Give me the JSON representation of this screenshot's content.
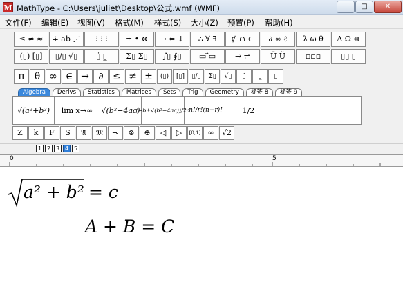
{
  "window": {
    "title": "MathType - C:\\Users\\juliet\\Desktop\\公式.wmf (WMF)",
    "app_icon_glyph": "M",
    "minimize": "─",
    "maximize": "□",
    "close": "✕"
  },
  "menu": [
    "文件(F)",
    "编辑(E)",
    "视图(V)",
    "格式(M)",
    "样式(S)",
    "大小(Z)",
    "预置(P)",
    "帮助(H)"
  ],
  "palette_row1": [
    "≤ ≠ ≈",
    "∔ ab ⋰",
    "⁝ ⁝ ⁝",
    "± • ⊗",
    "→ ⇔ ↓",
    "∴ ∀ ∃",
    "∉ ∩ ⊂",
    "∂ ∞ ℓ",
    "λ ω θ",
    "Λ Ω ⊛"
  ],
  "palette_row2": [
    "(▯) [▯]",
    "▯/▯ √▯",
    "▯̇ ▯̲",
    "Σ▯ Σ▯",
    "∫▯ ∮▯",
    "▭ ⃗▭",
    "→ ⇌",
    "Ū Ǔ",
    "▫▫▫",
    "▯▯ ▯"
  ],
  "symbols": [
    "π",
    "θ",
    "∞",
    "∈",
    "→",
    "∂",
    "≤",
    "≠",
    "±",
    "(▯)",
    "[▯]",
    "▯/▯",
    "Σ▯",
    "√▯",
    "▯̇",
    "▯̲",
    "▯"
  ],
  "tabs": [
    "Algebra",
    "Derivs",
    "Statistics",
    "Matrices",
    "Sets",
    "Trig",
    "Geometry",
    "标签 8",
    "标签 9"
  ],
  "templates": [
    "√(a²+b²)",
    "lim x→∞",
    "√(b²−4ac)",
    "(−b±√(b²−4ac))/2a",
    "n!/r!(n−r)!",
    "1/2"
  ],
  "small_symbols": [
    "Z",
    "k",
    "F",
    "S",
    "𝔄",
    "𝔐",
    "⊸",
    "⊗",
    "⊕",
    "◁",
    "▷",
    "[0,1]",
    "∞",
    "√2"
  ],
  "size_tabs": [
    "1",
    "2",
    "3",
    "4",
    "5"
  ],
  "selected_size_tab": 3,
  "ruler": {
    "start": "0",
    "mark": "5"
  },
  "equations": {
    "line1_lhs": "a² + b²",
    "line1_rhs": "= c",
    "line2": "A + B = C"
  }
}
